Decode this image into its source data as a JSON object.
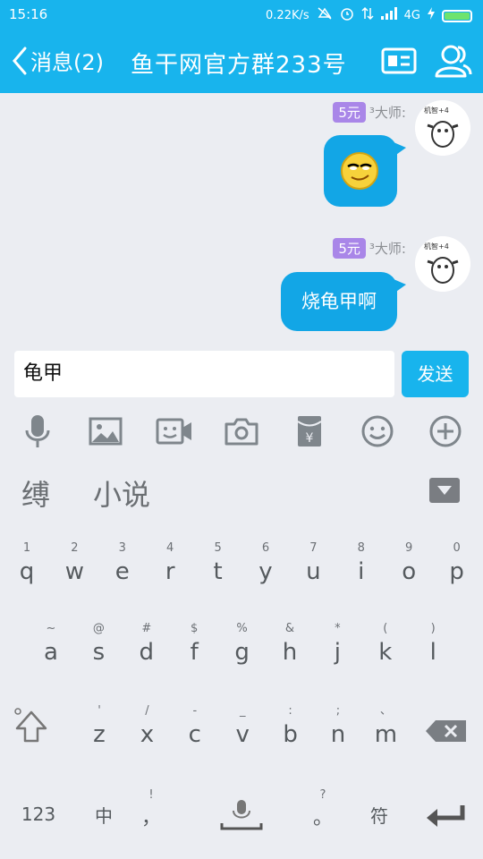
{
  "status_bar": {
    "time": "15:16",
    "net_speed": "0.22K/s",
    "network": "4G"
  },
  "title_bar": {
    "back_label": "消息(2)",
    "group_name": "鱼干网官方群233号"
  },
  "messages": [
    {
      "badge": "5元",
      "sender": "³大师:",
      "content_type": "emoji",
      "emoji": "smug-face"
    },
    {
      "badge": "5元",
      "sender": "³大师:",
      "content_type": "text",
      "text": "烧龟甲啊"
    }
  ],
  "input": {
    "value": "龟甲",
    "send_label": "发送"
  },
  "tools": [
    "microphone-icon",
    "image-icon",
    "video-call-icon",
    "camera-icon",
    "red-packet-icon",
    "emoji-icon",
    "plus-icon"
  ],
  "candidates": [
    "缚",
    "小说"
  ],
  "keyboard": {
    "row1": [
      {
        "hint": "1",
        "key": "q"
      },
      {
        "hint": "2",
        "key": "w"
      },
      {
        "hint": "3",
        "key": "e"
      },
      {
        "hint": "4",
        "key": "r"
      },
      {
        "hint": "5",
        "key": "t"
      },
      {
        "hint": "6",
        "key": "y"
      },
      {
        "hint": "7",
        "key": "u"
      },
      {
        "hint": "8",
        "key": "i"
      },
      {
        "hint": "9",
        "key": "o"
      },
      {
        "hint": "0",
        "key": "p"
      }
    ],
    "row2": [
      {
        "hint": "~",
        "key": "a"
      },
      {
        "hint": "@",
        "key": "s"
      },
      {
        "hint": "#",
        "key": "d"
      },
      {
        "hint": "$",
        "key": "f"
      },
      {
        "hint": "%",
        "key": "g"
      },
      {
        "hint": "&",
        "key": "h"
      },
      {
        "hint": "*",
        "key": "j"
      },
      {
        "hint": "(",
        "key": "k"
      },
      {
        "hint": ")",
        "key": "l"
      }
    ],
    "row3": [
      {
        "hint": "'",
        "key": "z"
      },
      {
        "hint": "/",
        "key": "x"
      },
      {
        "hint": "-",
        "key": "c"
      },
      {
        "hint": "_",
        "key": "v"
      },
      {
        "hint": ":",
        "key": "b"
      },
      {
        "hint": ";",
        "key": "n"
      },
      {
        "hint": "、",
        "key": "m"
      }
    ],
    "row4": {
      "num_label": "123",
      "lang_label": "中",
      "comma_hint": "!",
      "comma_label": "，",
      "period_hint": "?",
      "period_label": "。",
      "symbol_label": "符"
    }
  },
  "colors": {
    "accent": "#18b4ed",
    "bubble": "#12a6e6",
    "badge": "#a986e8"
  }
}
